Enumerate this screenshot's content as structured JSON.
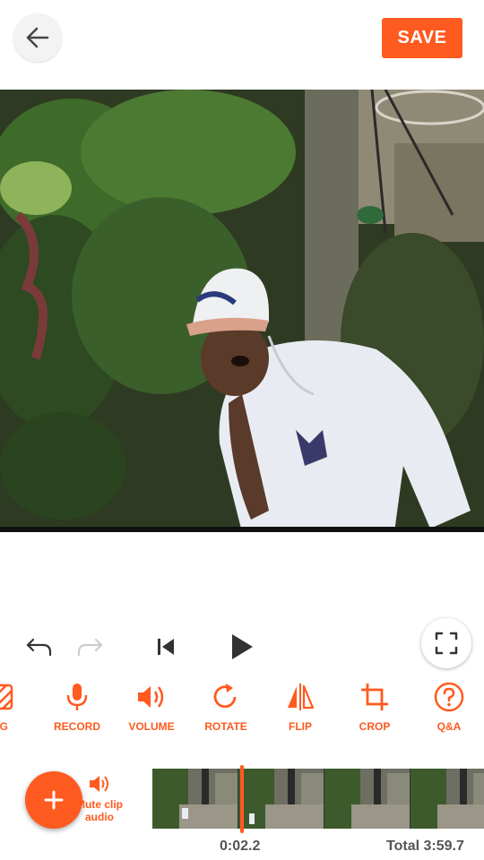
{
  "header": {
    "back_icon": "arrow-left-icon",
    "save_label": "SAVE"
  },
  "colors": {
    "accent": "#ff5a1f",
    "icon_dark": "#333333",
    "icon_disabled": "#cccccc"
  },
  "playback": {
    "undo_icon": "undo-icon",
    "redo_icon": "redo-icon",
    "skip_start_icon": "skip-to-start-icon",
    "play_icon": "play-icon",
    "fullscreen_icon": "fullscreen-icon"
  },
  "toolbar": {
    "items": [
      {
        "label": "BG",
        "icon": "background-icon"
      },
      {
        "label": "RECORD",
        "icon": "microphone-icon"
      },
      {
        "label": "VOLUME",
        "icon": "volume-icon"
      },
      {
        "label": "ROTATE",
        "icon": "rotate-icon"
      },
      {
        "label": "FLIP",
        "icon": "flip-icon"
      },
      {
        "label": "CROP",
        "icon": "crop-icon"
      },
      {
        "label": "Q&A",
        "icon": "question-icon"
      }
    ]
  },
  "timeline": {
    "add_icon": "plus-icon",
    "mute_label_line1": "Mute clip",
    "mute_label_line2": "audio",
    "current_time": "0:02.2",
    "total_time": "Total 3:59.7"
  }
}
